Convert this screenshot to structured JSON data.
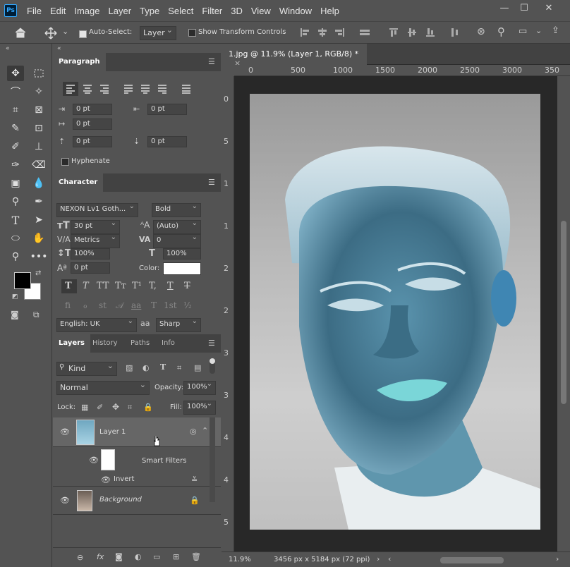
{
  "app": {
    "logo": "Ps",
    "menu": [
      "File",
      "Edit",
      "Image",
      "Layer",
      "Type",
      "Select",
      "Filter",
      "3D",
      "View",
      "Window",
      "Help"
    ]
  },
  "window_controls": {
    "minimize": "—",
    "maximize": "☐",
    "close": "✕"
  },
  "options": {
    "auto_select_label": "Auto-Select:",
    "auto_select_value": "Layer",
    "show_transform_label": "Show Transform Controls"
  },
  "paragraph": {
    "title": "Paragraph",
    "indent_left": "0 pt",
    "indent_right": "0 pt",
    "indent_first": "0 pt",
    "space_before": "0 pt",
    "space_after": "0 pt",
    "hyphenate": "Hyphenate"
  },
  "character": {
    "title": "Character",
    "font_family": "NEXON Lv1 Goth...",
    "font_style": "Bold",
    "font_size": "30 pt",
    "leading": "(Auto)",
    "kerning": "Metrics",
    "tracking": "0",
    "vscale": "100%",
    "hscale": "100%",
    "baseline": "0 pt",
    "color_label": "Color:",
    "color": "#ffffff",
    "language": "English: UK",
    "aa_glyph": "aa",
    "antialias": "Sharp",
    "type_buttons": [
      "T",
      "T",
      "TT",
      "Tт",
      "T¹",
      "T,",
      "T",
      "T"
    ],
    "ot_buttons": [
      "fi",
      "ℴ",
      "st",
      "𝒜",
      "aa",
      "T",
      "1st",
      "½"
    ]
  },
  "layers": {
    "tabs": [
      "Layers",
      "History",
      "Paths",
      "Info"
    ],
    "filter_kind": "Kind",
    "blend_mode": "Normal",
    "opacity_label": "Opacity:",
    "opacity": "100%",
    "lock_label": "Lock:",
    "fill_label": "Fill:",
    "fill": "100%",
    "items": [
      {
        "name": "Layer 1"
      },
      {
        "name": "Smart Filters"
      },
      {
        "name": "Invert"
      },
      {
        "name": "Background"
      }
    ]
  },
  "document": {
    "tab_title": "1.jpg @ 11.9% (Layer 1, RGB/8) *",
    "close": "×",
    "ruler_top": [
      "0",
      "500",
      "1000",
      "1500",
      "2000",
      "2500",
      "3000",
      "350"
    ],
    "ruler_left": [
      "0",
      "5",
      "1",
      "1",
      "2",
      "2",
      "3",
      "3",
      "4",
      "4",
      "5"
    ],
    "zoom": "11.9%",
    "dimensions": "3456 px x 5184 px (72 ppi)"
  }
}
